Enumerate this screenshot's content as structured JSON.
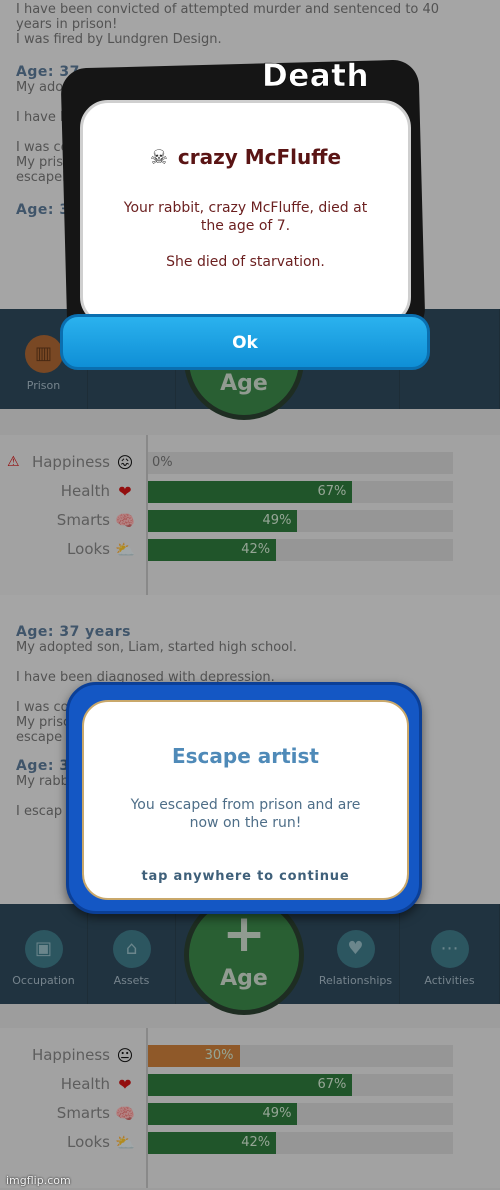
{
  "top": {
    "log": [
      "I have been convicted of attempted murder and sentenced to 40",
      "years in prison!",
      "I was fired by Lundgren Design."
    ],
    "partial_year": "Age: 37 ye",
    "partial_lines": [
      "My adopt",
      "I have b",
      "I was co",
      "My prisc",
      "escapel"
    ],
    "partial_year2": "Age: 3",
    "prison_tab": "Prison",
    "age_label": "Age"
  },
  "death_modal": {
    "title": "Death",
    "pet_name": "crazy McFluffe",
    "skull_icon": "☠",
    "message_1": "Your rabbit, crazy McFluffe, died at the age of 7.",
    "message_2": "She died of starvation.",
    "ok_label": "Ok"
  },
  "stats_top": {
    "happiness": {
      "label": "Happiness",
      "value": 0,
      "text": "0%"
    },
    "health": {
      "label": "Health",
      "value": 67,
      "text": "67%"
    },
    "smarts": {
      "label": "Smarts",
      "value": 49,
      "text": "49%"
    },
    "looks": {
      "label": "Looks",
      "value": 42,
      "text": "42%"
    }
  },
  "bottom": {
    "year": "Age: 37 years",
    "line1": "My adopted son, Liam, started high school.",
    "line2": "I have been diagnosed with depression.",
    "partial_lines": [
      "I was co",
      "My prisc",
      "escape",
      "Age: 3",
      "My rabb",
      "I escap"
    ]
  },
  "escape_modal": {
    "title": "Escape artist",
    "message": "You escaped from prison and are now on the run!",
    "tap": "tap anywhere to continue"
  },
  "tabs": {
    "occupation": "Occupation",
    "assets": "Assets",
    "age": "Age",
    "relationships": "Relationships",
    "activities": "Activities"
  },
  "stats_bottom": {
    "happiness": {
      "label": "Happiness",
      "value": 30,
      "text": "30%"
    },
    "health": {
      "label": "Health",
      "value": 67,
      "text": "67%"
    },
    "smarts": {
      "label": "Smarts",
      "value": 49,
      "text": "49%"
    },
    "looks": {
      "label": "Looks",
      "value": 42,
      "text": "42%"
    }
  },
  "watermark": "imgflip.com",
  "colors": {
    "health_fill": "#1c6e2c",
    "happiness_fill": "#c7742a",
    "ok_blue": "#1a9fe0",
    "escape_frame": "#1457c4"
  }
}
